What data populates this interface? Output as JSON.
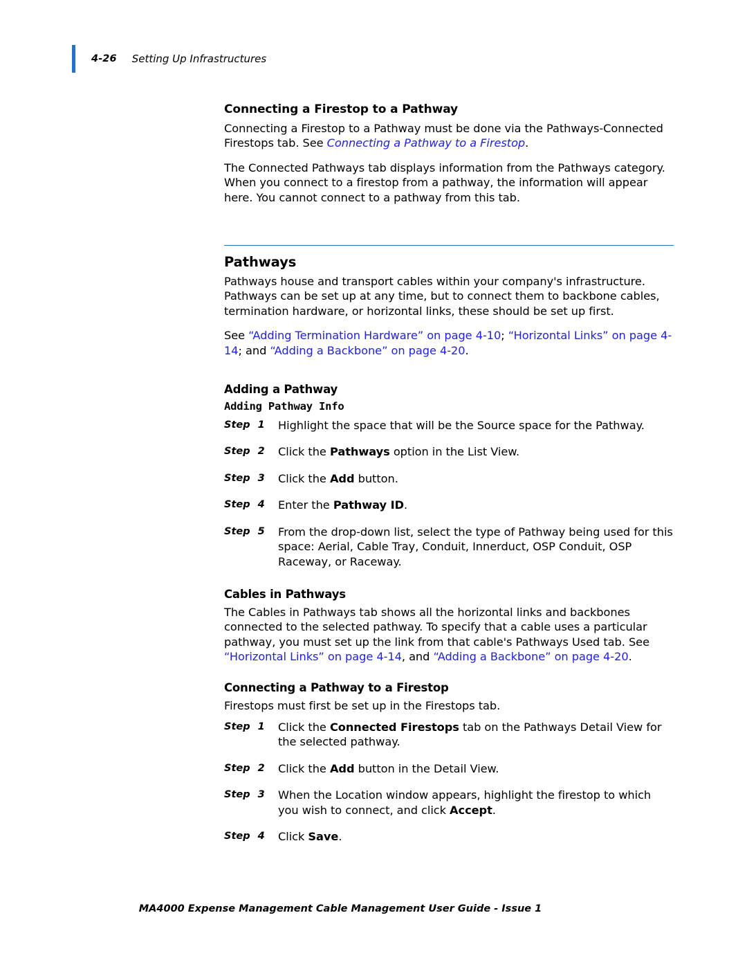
{
  "header": {
    "page_number": "4-26",
    "chapter_title": "Setting Up Infrastructures",
    "accent_color": "#2a72c0"
  },
  "colors": {
    "link": "#2222dd",
    "rule": "#2f74b5",
    "accent_bar": "#2a72c0",
    "text": "#000000"
  },
  "sections": {
    "connecting_firestop_to_pathway": {
      "heading": "Connecting a Firestop to a Pathway",
      "para1_part1": "Connecting a Firestop to a Pathway must be done via the Pathways-Connected Firestops tab. See ",
      "para1_link": "Connecting a Pathway to a Firestop",
      "para1_part2": ".",
      "para2": "The Connected Pathways tab displays information from the Pathways category. When you connect to a firestop from a pathway, the information will appear here. You cannot connect to a pathway from this tab."
    },
    "pathways": {
      "heading": "Pathways",
      "para1": "Pathways house and transport cables within your company's infrastructure. Pathways can be set up at any time, but to connect them to backbone cables, termination hardware, or horizontal links, these should be set up first.",
      "xref_see": "See ",
      "xref_link1": "“Adding Termination Hardware” on page 4-10",
      "xref_sep1": "; ",
      "xref_link2": "“Horizontal Links” on page 4-14",
      "xref_sep2": "; and ",
      "xref_link3": "“Adding a Backbone” on page 4-20",
      "xref_end": "."
    },
    "adding_a_pathway": {
      "heading": "Adding a Pathway",
      "sub_heading": "Adding Pathway Info",
      "steps": [
        {
          "label": "Step",
          "number": "1",
          "text_before": "Highlight the space that will be the Source space for the Pathway.",
          "bold": "",
          "text_after": ""
        },
        {
          "label": "Step",
          "number": "2",
          "text_before": "Click the ",
          "bold": "Pathways",
          "text_after": " option in the List View."
        },
        {
          "label": "Step",
          "number": "3",
          "text_before": "Click the ",
          "bold": "Add",
          "text_after": " button."
        },
        {
          "label": "Step",
          "number": "4",
          "text_before": "Enter the ",
          "bold": "Pathway ID",
          "text_after": "."
        },
        {
          "label": "Step",
          "number": "5",
          "text_before": "From the drop-down list, select the type of Pathway being used for this space: Aerial, Cable Tray, Conduit, Innerduct, OSP Conduit, OSP Raceway, or Raceway.",
          "bold": "",
          "text_after": ""
        }
      ]
    },
    "cables_in_pathways": {
      "heading": "Cables in Pathways",
      "para_part1": "The Cables in Pathways tab shows all the horizontal links and backbones connected to the selected pathway. To specify that a cable uses a particular pathway, you must set up the link from that cable's Pathways Used tab. See ",
      "link1": "“Horizontal Links” on page 4-14",
      "sep1": ", and ",
      "link2": "“Adding a Backbone” on page 4-20",
      "end": "."
    },
    "connecting_pathway_to_firestop": {
      "heading": "Connecting a Pathway to a Firestop",
      "intro": "Firestops must first be set up in the Firestops tab.",
      "steps": [
        {
          "label": "Step",
          "number": "1",
          "text_before": "Click the ",
          "bold": "Connected Firestops",
          "text_after": " tab on the Pathways Detail View for the selected pathway."
        },
        {
          "label": "Step",
          "number": "2",
          "text_before": "Click the ",
          "bold": "Add",
          "text_after": " button in the Detail View."
        },
        {
          "label": "Step",
          "number": "3",
          "text_before": "When the Location window appears, highlight the firestop to which you wish to connect, and click ",
          "bold": "Accept",
          "text_after": "."
        },
        {
          "label": "Step",
          "number": "4",
          "text_before": "Click ",
          "bold": "Save",
          "text_after": "."
        }
      ]
    }
  },
  "footer": {
    "text": "MA4000 Expense Management Cable Management User Guide - Issue 1"
  }
}
